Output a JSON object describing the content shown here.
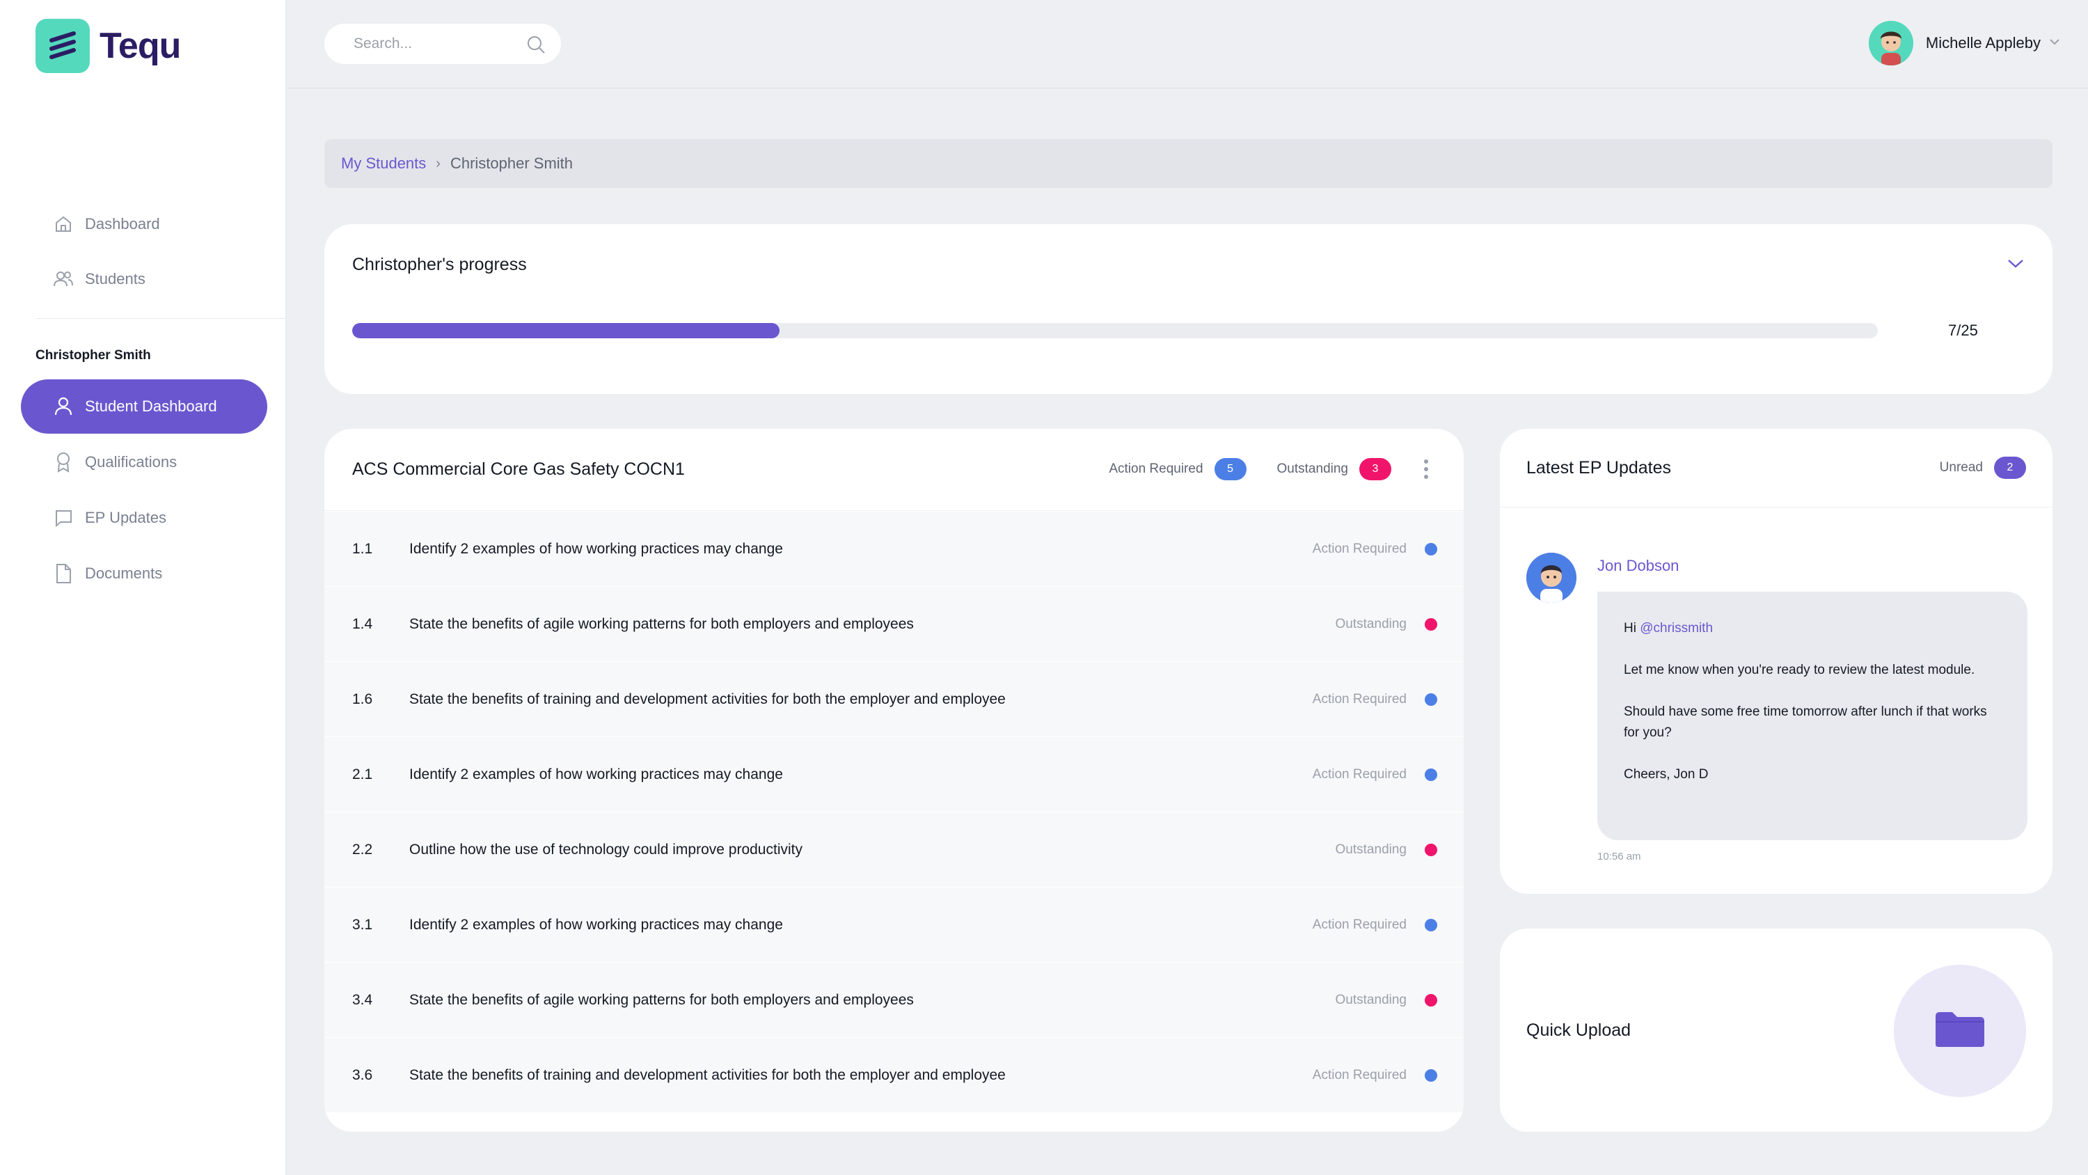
{
  "brand": {
    "name": "Tequ",
    "accent": "#6a57cf",
    "logo_color": "#55d9bc"
  },
  "search": {
    "placeholder": "Search..."
  },
  "user": {
    "name": "Michelle Appleby"
  },
  "sidebar": {
    "main_items": [
      {
        "label": "Dashboard",
        "icon": "home-icon"
      },
      {
        "label": "Students",
        "icon": "users-icon"
      }
    ],
    "section_title": "Christopher Smith",
    "student_items": [
      {
        "label": "Student Dashboard",
        "icon": "user-icon",
        "active": true
      },
      {
        "label": "Qualifications",
        "icon": "award-icon"
      },
      {
        "label": "EP Updates",
        "icon": "chat-icon"
      },
      {
        "label": "Documents",
        "icon": "document-icon"
      }
    ]
  },
  "breadcrumb": {
    "parent": "My Students",
    "separator": "›",
    "current": "Christopher Smith"
  },
  "progress": {
    "title": "Christopher's progress",
    "completed": 7,
    "total": 25,
    "label": "7/25"
  },
  "modules": {
    "title": "ACS Commercial Core Gas Safety COCN1",
    "action_required_label": "Action Required",
    "action_required_count": "5",
    "outstanding_label": "Outstanding",
    "outstanding_count": "3",
    "status_colors": {
      "Action Required": "#4c7fe6",
      "Outstanding": "#f0156a"
    },
    "rows": [
      {
        "num": "1.1",
        "text": "Identify 2 examples of how working practices may change",
        "status": "Action Required"
      },
      {
        "num": "1.4",
        "text": "State the benefits of agile working patterns for both employers and employees",
        "status": "Outstanding"
      },
      {
        "num": "1.6",
        "text": "State the benefits of training and development activities for both the employer and employee",
        "status": "Action Required"
      },
      {
        "num": "2.1",
        "text": "Identify 2 examples of how working practices may change",
        "status": "Action Required"
      },
      {
        "num": "2.2",
        "text": "Outline how the use of technology could improve productivity",
        "status": "Outstanding"
      },
      {
        "num": "3.1",
        "text": "Identify 2 examples of how working practices may change",
        "status": "Action Required"
      },
      {
        "num": "3.4",
        "text": "State the benefits of agile working patterns for both employers and employees",
        "status": "Outstanding"
      },
      {
        "num": "3.6",
        "text": "State the benefits of training and development activities for both the employer and employee",
        "status": "Action Required"
      }
    ]
  },
  "updates": {
    "title": "Latest EP Updates",
    "unread_label": "Unread",
    "unread_count": "2",
    "message": {
      "author": "Jon Dobson",
      "greeting": "Hi",
      "mention": "@chrissmith",
      "line1": "Let me know when you're ready to review the latest module.",
      "line2": "Should have some free time tomorrow after lunch if that works for you?",
      "signoff": "Cheers, Jon D",
      "time": "10:56 am"
    }
  },
  "upload": {
    "title": "Quick Upload",
    "icon": "folder-icon"
  }
}
